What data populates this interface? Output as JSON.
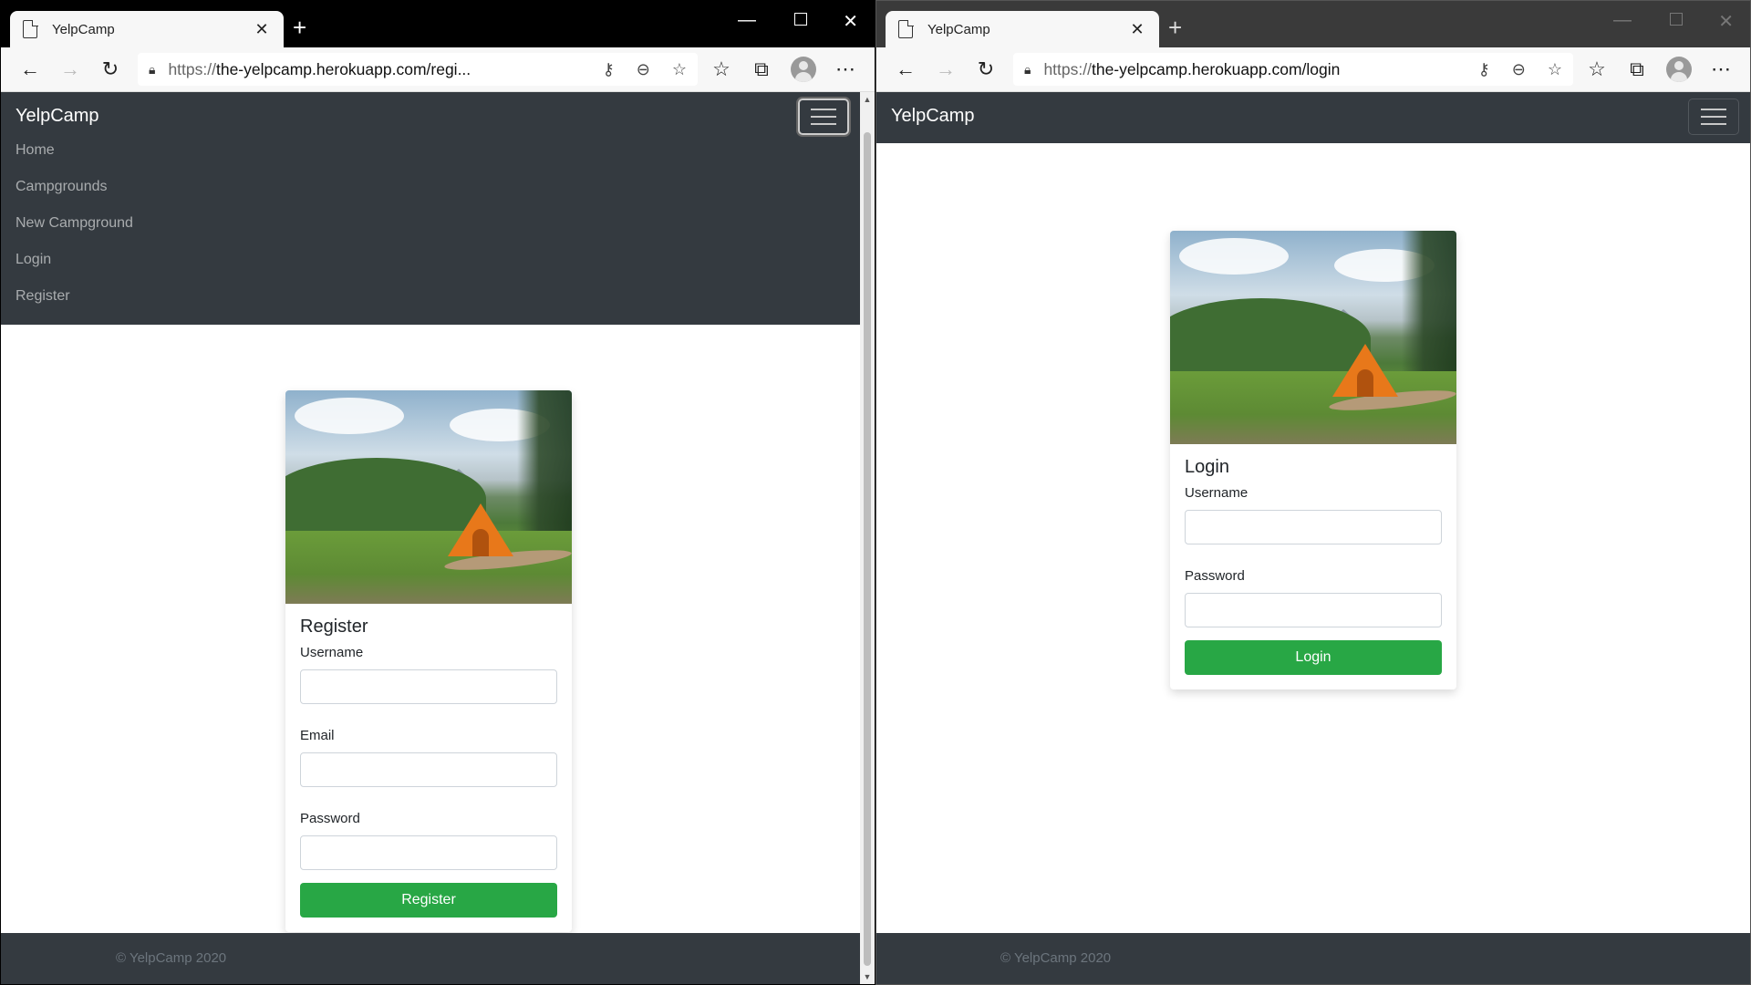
{
  "left_window": {
    "tab_title": "YelpCamp",
    "url_protocol": "https://",
    "url_rest": "the-yelpcamp.herokuapp.com/regi...",
    "brand": "YelpCamp",
    "nav_links": [
      "Home",
      "Campgrounds",
      "New Campground",
      "Login",
      "Register"
    ],
    "card": {
      "title": "Register",
      "fields": [
        {
          "label": "Username",
          "value": ""
        },
        {
          "label": "Email",
          "value": ""
        },
        {
          "label": "Password",
          "value": ""
        }
      ],
      "button": "Register"
    },
    "footer": "© YelpCamp 2020"
  },
  "right_window": {
    "tab_title": "YelpCamp",
    "url_protocol": "https://",
    "url_rest": "the-yelpcamp.herokuapp.com/login",
    "brand": "YelpCamp",
    "card": {
      "title": "Login",
      "fields": [
        {
          "label": "Username",
          "value": ""
        },
        {
          "label": "Password",
          "value": ""
        }
      ],
      "button": "Login"
    },
    "footer": "© YelpCamp 2020"
  },
  "icons": {
    "tab": "page-icon",
    "close": "close-icon",
    "new_tab": "plus-icon",
    "back": "back-arrow-icon",
    "forward": "forward-arrow-icon",
    "refresh": "refresh-icon",
    "lock": "lock-icon",
    "key": "key-icon",
    "zoom": "zoom-out-icon",
    "favorite": "add-favorite-icon",
    "favorites": "favorites-icon",
    "collections": "collections-icon",
    "profile": "profile-icon",
    "more": "more-icon",
    "menu": "hamburger-icon"
  },
  "colors": {
    "navbar": "#343a40",
    "success_button": "#28a745",
    "nav_link": "#a9acae"
  }
}
